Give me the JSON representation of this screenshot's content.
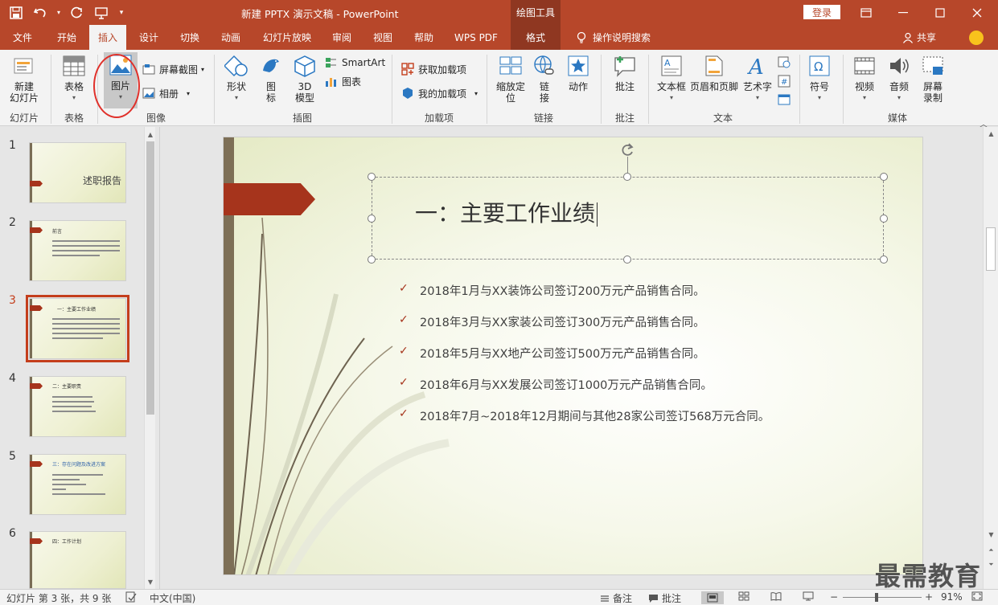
{
  "titlebar": {
    "title": "新建 PPTX 演示文稿  -  PowerPoint",
    "context_tool": "绘图工具",
    "login": "登录"
  },
  "tabs": [
    "文件",
    "开始",
    "插入",
    "设计",
    "切换",
    "动画",
    "幻灯片放映",
    "审阅",
    "视图",
    "帮助",
    "WPS PDF",
    "格式"
  ],
  "active_tab": "插入",
  "search": "操作说明搜索",
  "share": "共享",
  "ribbon": {
    "new_slide": "新建\n幻灯片",
    "table": "表格",
    "picture": "图片",
    "screenshot": "屏幕截图",
    "album": "相册",
    "shapes": "形状",
    "icons": "图\n标",
    "model3d": "3D\n模型",
    "smartart": "SmartArt",
    "chart": "图表",
    "get_addins": "获取加载项",
    "my_addins": "我的加载项",
    "zoom": "缩放定\n位",
    "link": "链\n接",
    "action": "动作",
    "comment": "批注",
    "textbox": "文本框",
    "header_footer": "页眉和页脚",
    "wordart": "艺术字",
    "symbol": "符号",
    "video": "视频",
    "audio": "音频",
    "screen_record": "屏幕\n录制",
    "groups": {
      "slides": "幻灯片",
      "tables": "表格",
      "images": "图像",
      "illustrations": "插图",
      "addins": "加载项",
      "links": "链接",
      "comments": "批注",
      "text": "文本",
      "media": "媒体"
    }
  },
  "thumbnails": [
    {
      "num": "1",
      "title": "述职报告"
    },
    {
      "num": "2",
      "title": "前言"
    },
    {
      "num": "3",
      "title": "一：主要工作业绩"
    },
    {
      "num": "4",
      "title": "二：主要职责"
    },
    {
      "num": "5",
      "title": "三：存在问题及改进方案"
    },
    {
      "num": "6",
      "title": "四：工作计划"
    }
  ],
  "active_slide": 3,
  "slide": {
    "title": "一：主要工作业绩",
    "bullets": [
      "2018年1月与XX装饰公司签订200万元产品销售合同。",
      "2018年3月与XX家装公司签订300万元产品销售合同。",
      "2018年5月与XX地产公司签订500万元产品销售合同。",
      "2018年6月与XX发展公司签订1000万元产品销售合同。",
      "2018年7月~2018年12月期间与其他28家公司签订568万元合同。"
    ]
  },
  "statusbar": {
    "slide_info": "幻灯片 第 3 张，共 9 张",
    "language": "中文(中国)",
    "notes": "备注",
    "comments": "批注",
    "zoom": "91%"
  },
  "watermark": "最需教育",
  "colors": {
    "accent": "#b7472a",
    "context": "#8f3721",
    "slide_flag": "#a6341c"
  }
}
